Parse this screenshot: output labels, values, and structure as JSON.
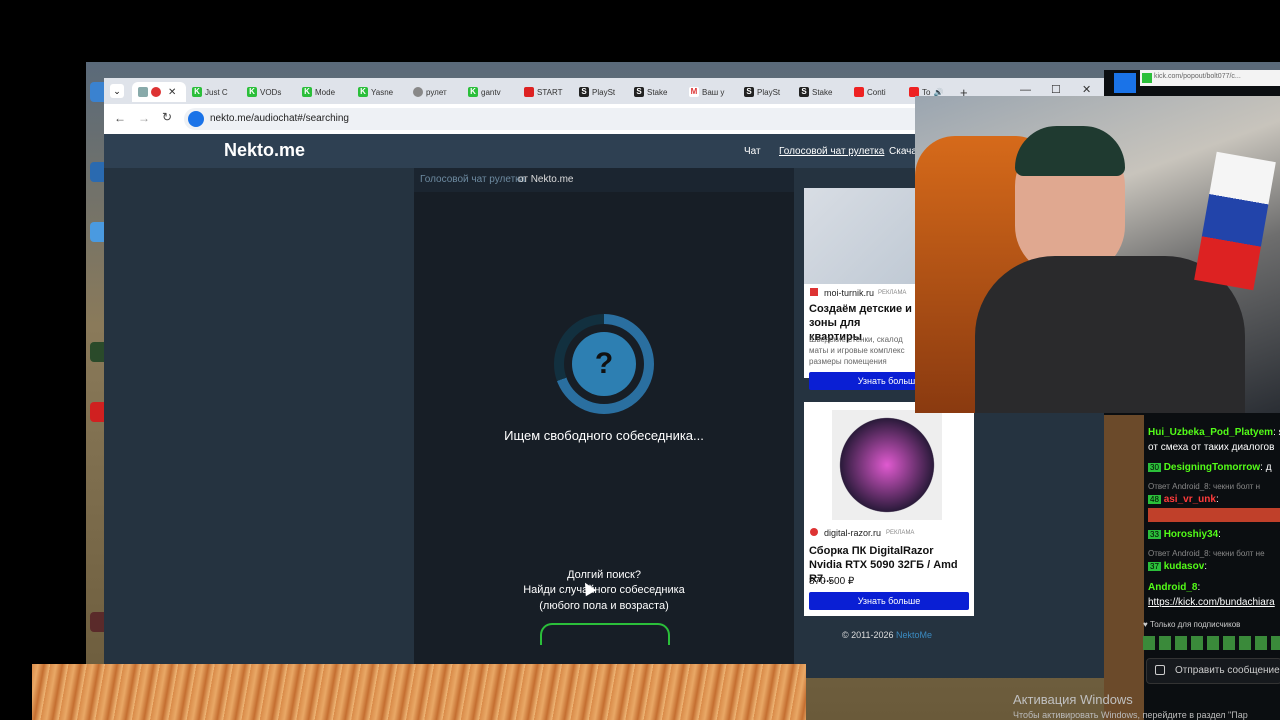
{
  "browser": {
    "tabs": [
      {
        "label": "",
        "icon": "record-icon"
      },
      {
        "label": "Just C",
        "icon": "kick-icon"
      },
      {
        "label": "VODs",
        "icon": "kick-icon"
      },
      {
        "label": "Mode",
        "icon": "kick-icon"
      },
      {
        "label": "Yasne",
        "icon": "kick-icon"
      },
      {
        "label": "рулет",
        "icon": "globe-icon"
      },
      {
        "label": "gantv",
        "icon": "kick-icon"
      },
      {
        "label": "START",
        "icon": "start-icon"
      },
      {
        "label": "PlaySt",
        "icon": "s-icon"
      },
      {
        "label": "Stake",
        "icon": "s-icon"
      },
      {
        "label": "Ваш у",
        "icon": "gmail-icon"
      },
      {
        "label": "PlaySt",
        "icon": "s-icon"
      },
      {
        "label": "Stake",
        "icon": "s-icon"
      },
      {
        "label": "Conti",
        "icon": "youtube-icon"
      },
      {
        "label": "To",
        "icon": "youtube-icon"
      }
    ],
    "new_tab": "+",
    "url": "nekto.me/audiochat#/searching",
    "popout_url": "kick.com/popout/bolt077/c..."
  },
  "site": {
    "logo": "Nekto.me",
    "nav": [
      "Чат",
      "Голосовой чат рулетка",
      "Скачат"
    ],
    "breadcrumb_link": "Голосовой чат рулетка",
    "breadcrumb_rest": " от Nekto.me",
    "search_icon_text": "?",
    "searching_text": "Ищем свободного собеседника...",
    "long_search_1": "Долгий поиск?",
    "long_search_2": "Найди случайного собеседника",
    "long_search_3": "(любого пола и возраста)",
    "copyright": "© 2011-2026 ",
    "copyright_link": "NektoMe"
  },
  "ads": [
    {
      "domain": "moi-turnik.ru",
      "badge": "РЕКЛАМА",
      "title": "Создаём детские и зоны для квартиры",
      "desc": "Шведские стенки, скалод маты и игровые комплекс размеры помещения",
      "button": "Узнать больше"
    },
    {
      "domain": "digital-razor.ru",
      "badge": "РЕКЛАМА",
      "title": "Сборка ПК DigitalRazor Nvidia RTX 5090 32ГБ / Amd R7...",
      "price": "870 500 ₽",
      "button": "Узнать больше"
    }
  ],
  "chat": {
    "lines": [
      {
        "user": "Hui_Uzbeka_Pod_Platyem",
        "text": ": я"
      },
      {
        "user": "",
        "text": "от смеха от таких диалогов"
      },
      {
        "user": "DesigningTomorrow",
        "text": ": д",
        "badge": "30"
      },
      {
        "reply": "Ответ Android_8: чекни болт н"
      },
      {
        "user": "asi_vr_unk",
        "text": ":",
        "badge": "48"
      },
      {
        "user": "Horoshiy34",
        "text": ":",
        "badge": "33"
      },
      {
        "reply": "Ответ Android_8: чекни болт не"
      },
      {
        "user": "kudasov",
        "text": ":",
        "badge": "37"
      },
      {
        "user": "Android_8",
        "text": ":"
      },
      {
        "user": "",
        "link": "https://kick.com/bundachiara"
      }
    ],
    "subscribers_only": "Только для подписчиков",
    "send_placeholder": "Отправить сообщение"
  },
  "windows": {
    "activate_title": "Активация Windows",
    "activate_text": "Чтобы активировать Windows, перейдите в раздел \"Пар"
  }
}
